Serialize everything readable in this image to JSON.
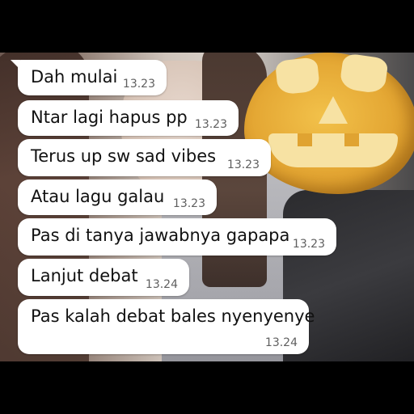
{
  "messages": [
    {
      "text": "Dah mulai",
      "time": "13.23"
    },
    {
      "text": "Ntar lagi hapus pp",
      "time": "13.23"
    },
    {
      "text": "Terus up sw sad vibes",
      "time": "13.23"
    },
    {
      "text": "Atau lagu galau",
      "time": "13.23"
    },
    {
      "text": "Pas di tanya jawabnya gapapa",
      "time": "13.23"
    },
    {
      "text": "Lanjut debat",
      "time": "13.24"
    },
    {
      "text": "Pas kalah debat bales nyenyenye",
      "time": "13.24"
    }
  ],
  "colors": {
    "bubble": "#ffffff",
    "text": "#111111",
    "timestamp": "#5f5f5f",
    "frame": "#000000"
  }
}
